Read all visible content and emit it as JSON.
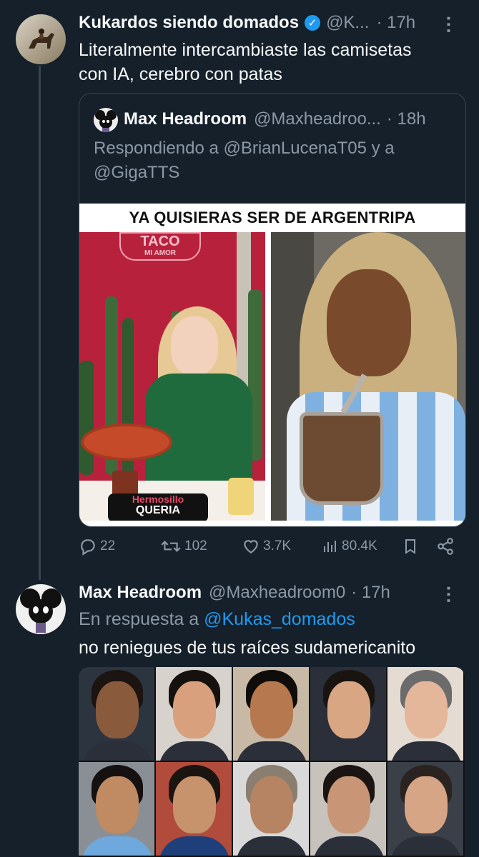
{
  "tweet1": {
    "display_name": "Kukardos siendo domados",
    "handle": "@K...",
    "time": "· 17h",
    "text_line1": "Literalmente intercambiaste las camisetas",
    "text_line2": "con IA, cerebro con patas"
  },
  "quote": {
    "display_name": "Max Headroom",
    "handle": "@Maxheadroo...",
    "time": "· 18h",
    "reply_line1": "Respondiendo a @BrianLucenaT05 y a",
    "reply_line2": "@GigaTTS",
    "meme_title": "YA QUISIERAS SER DE ARGENTRIPA",
    "sign_text1": "TACO",
    "sign_text2": "MI AMOR",
    "placemat_text": "Hermosillo",
    "placemat_text2": "QUERIA"
  },
  "actions": {
    "replies": "22",
    "retweets": "102",
    "likes": "3.7K",
    "views": "80.4K"
  },
  "tweet2": {
    "display_name": "Max Headroom",
    "handle": "@Maxheadroom0",
    "time": "· 17h",
    "reply_prefix": "En respuesta a",
    "reply_to": "@Kukas_domados",
    "text": "no reniegues de tus raíces sudamericanito"
  },
  "colors": {
    "background": "#15202b",
    "accent": "#1d9bf0",
    "muted": "#8b98a5",
    "border": "#38444d"
  }
}
